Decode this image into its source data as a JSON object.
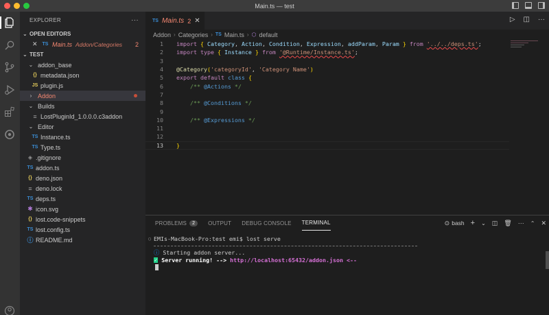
{
  "window": {
    "title": "Main.ts — test"
  },
  "colors": {
    "close": "#ff5f57",
    "minimize": "#febc2e",
    "zoom": "#28c840",
    "accent": "#007acc"
  },
  "activity_bar": [
    "explorer-icon",
    "search-icon",
    "source-control-icon",
    "run-debug-icon",
    "extensions-icon",
    "remote-icon",
    "account-icon"
  ],
  "sidebar": {
    "title": "EXPLORER",
    "more": "···",
    "open_editors": {
      "label": "OPEN EDITORS",
      "items": [
        {
          "icon": "TS",
          "name": "Main.ts",
          "path": "Addon/Categories",
          "count": "2"
        }
      ]
    },
    "workspace": "TEST",
    "tree": [
      {
        "chev": "⌄",
        "label": "addon_base",
        "indent": 11
      },
      {
        "icon": "{}",
        "label": "metadata.json",
        "indent": 22
      },
      {
        "icon": "JS",
        "label": "plugin.js",
        "indent": 22
      },
      {
        "chev": "›",
        "label": "Addon",
        "indent": 11
      },
      {
        "chev": "⌄",
        "label": "Builds",
        "indent": 11
      },
      {
        "icon": "≡",
        "label": "LostPluginId_1.0.0.0.c3addon",
        "indent": 22
      },
      {
        "chev": "⌄",
        "label": "Editor",
        "indent": 11
      },
      {
        "icon": "TS",
        "label": "Instance.ts",
        "indent": 22
      },
      {
        "icon": "TS",
        "label": "Type.ts",
        "indent": 22
      },
      {
        "icon": "◈",
        "label": ".gitignore",
        "indent": 11
      },
      {
        "icon": "TS",
        "label": "addon.ts",
        "indent": 11
      },
      {
        "icon": "{}",
        "label": "deno.json",
        "indent": 11
      },
      {
        "icon": "≡",
        "label": "deno.lock",
        "indent": 11
      },
      {
        "icon": "TS",
        "label": "deps.ts",
        "indent": 11
      },
      {
        "icon": "✱",
        "label": "icon.svg",
        "indent": 11
      },
      {
        "icon": "{}",
        "label": "lost.code-snippets",
        "indent": 11
      },
      {
        "icon": "TS",
        "label": "lost.config.ts",
        "indent": 11
      },
      {
        "icon": "ⓘ",
        "label": "README.md",
        "indent": 11
      }
    ]
  },
  "editor": {
    "tab": {
      "icon": "TS",
      "name": "Main.ts",
      "count": "2",
      "close": "✕"
    },
    "breadcrumb": [
      "Addon",
      "Categories",
      "Main.ts",
      "default"
    ],
    "breadcrumb_file_icon": "TS",
    "line_numbers": [
      "1",
      "2",
      "3",
      "4",
      "5",
      "6",
      "7",
      "8",
      "9",
      "10",
      "11",
      "12",
      "13"
    ],
    "current_line": "13"
  },
  "panel": {
    "tabs": [
      {
        "label": "PROBLEMS",
        "badge": "2"
      },
      {
        "label": "OUTPUT"
      },
      {
        "label": "DEBUG CONSOLE"
      },
      {
        "label": "TERMINAL",
        "active": true
      }
    ],
    "shell": "bash",
    "prompt": "EMIs-MacBook-Pro:test emi$ lost serve",
    "line1": "Starting addon server...",
    "line2_label": "Server running! -->",
    "line2_url": "http://localhost:65432/addon.json",
    "line2_tail": "<--"
  }
}
